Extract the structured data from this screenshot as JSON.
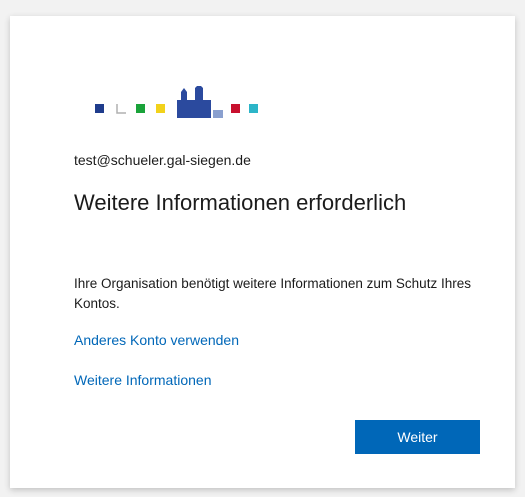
{
  "account": {
    "email": "test@schueler.gal-siegen.de"
  },
  "dialog": {
    "title": "Weitere Informationen erforderlich",
    "description": "Ihre Organisation benötigt weitere Informationen zum Schutz Ihres Kontos.",
    "link_other_account": "Anderes Konto verwenden",
    "link_more_info": "Weitere Informationen",
    "next_button": "Weiter"
  },
  "colors": {
    "accent": "#0067b8",
    "logo_squares": [
      "#1f3c8c",
      "#d9d9d9",
      "#1aa33a",
      "#f2d21b",
      "#c8102e",
      "#2cb5c8"
    ],
    "logo_building": "#2b4a9e"
  }
}
